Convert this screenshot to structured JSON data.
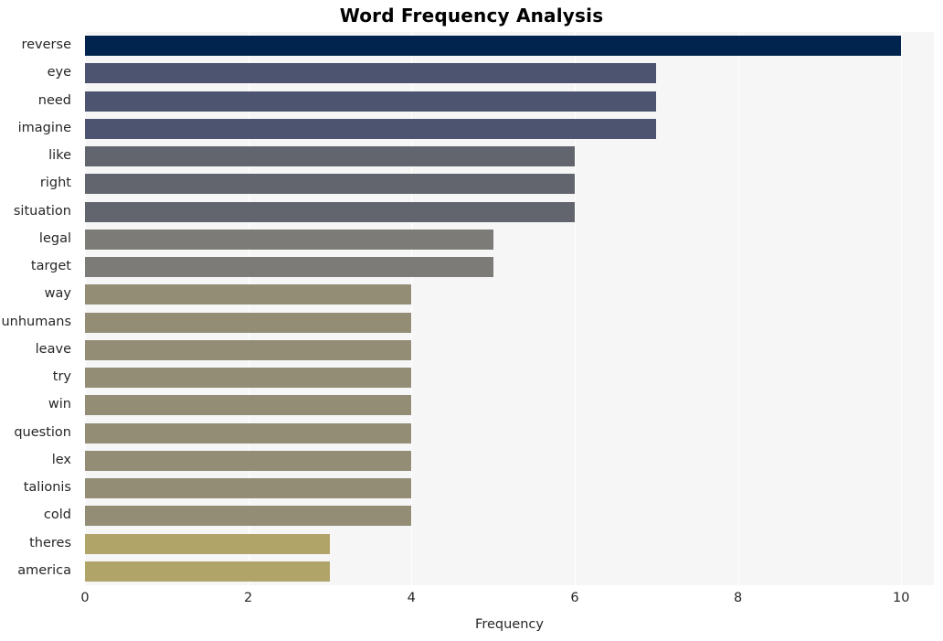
{
  "chart_data": {
    "type": "bar",
    "orientation": "horizontal",
    "title": "Word Frequency Analysis",
    "xlabel": "Frequency",
    "ylabel": "",
    "xlim": [
      0,
      10.4
    ],
    "xticks": [
      0,
      2,
      4,
      6,
      8,
      10
    ],
    "xtick_labels": [
      "0",
      "2",
      "4",
      "6",
      "8",
      "10"
    ],
    "grid": "vertical-white-on-light-gray",
    "legend": "none",
    "categories": [
      "reverse",
      "eye",
      "need",
      "imagine",
      "like",
      "right",
      "situation",
      "legal",
      "target",
      "way",
      "unhumans",
      "leave",
      "try",
      "win",
      "question",
      "lex",
      "talionis",
      "cold",
      "theres",
      "america"
    ],
    "values": [
      10,
      7,
      7,
      7,
      6,
      6,
      6,
      5,
      5,
      4,
      4,
      4,
      4,
      4,
      4,
      4,
      4,
      4,
      3,
      3
    ],
    "bar_colors": [
      "#00244e",
      "#4c5470",
      "#4c5470",
      "#4c5470",
      "#62656e",
      "#62656e",
      "#62656e",
      "#7c7b77",
      "#7c7b77",
      "#938d76",
      "#938d76",
      "#938d76",
      "#938d76",
      "#938d76",
      "#938d76",
      "#938d76",
      "#938d76",
      "#938d76",
      "#b0a469",
      "#b0a469"
    ]
  },
  "colors": {
    "figure_background": "#ffffff",
    "plot_background": "#f6f6f7",
    "gridline": "#ffffff",
    "text": "#262626",
    "title": "#000000"
  }
}
